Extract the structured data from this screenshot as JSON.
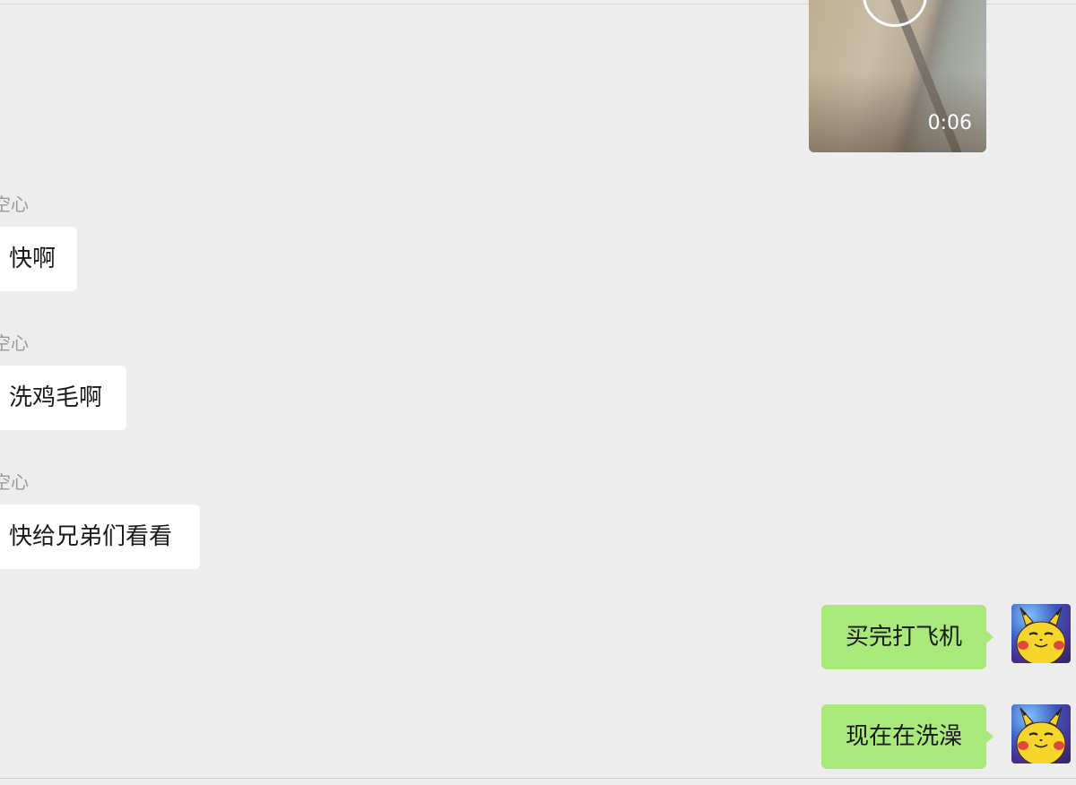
{
  "video_message": {
    "duration": "0:06"
  },
  "incoming_messages": [
    {
      "sender": "空心",
      "text": "快啊"
    },
    {
      "sender": "空心",
      "text": "洗鸡毛啊"
    },
    {
      "sender": "空心",
      "text": "快给兄弟们看看"
    }
  ],
  "outgoing_messages": [
    {
      "text": "买完打飞机",
      "avatar": "pikachu-avatar"
    },
    {
      "text": "现在在洗澡",
      "avatar": "pikachu-avatar"
    }
  ],
  "colors": {
    "background": "#ededed",
    "incoming_bubble": "#ffffff",
    "outgoing_bubble": "#a9e87a",
    "sender_name": "#9b9b9b"
  }
}
